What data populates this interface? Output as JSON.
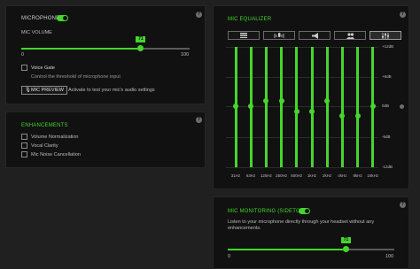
{
  "colors": {
    "accent": "#44d62c",
    "panel": "#111111",
    "background": "#202020"
  },
  "microphone": {
    "title": "MICROPHONE",
    "toggle_on": true,
    "volume_label": "MIC VOLUME",
    "volume_value": "71",
    "volume_percent": 71,
    "min_label": "0",
    "max_label": "100",
    "voice_gate_label": "Voice Gate",
    "voice_gate_desc": "Control the threshold of microphone input",
    "preview_button": "MIC PREVIEW",
    "preview_desc": "Activate to test your mic's audio settings",
    "help_icon": "question-icon"
  },
  "enhancements": {
    "title": "ENHANCEMENTS",
    "items": [
      {
        "label": "Volume Normalization",
        "checked": false
      },
      {
        "label": "Vocal Clarity",
        "checked": false
      },
      {
        "label": "Mic Noise Cancellation",
        "checked": false
      }
    ]
  },
  "equalizer": {
    "title": "MIC EQUALIZER",
    "presets": [
      {
        "icon": "default-preset-icon",
        "active": false
      },
      {
        "icon": "broadcast-mic-preset-icon",
        "active": false
      },
      {
        "icon": "megaphone-preset-icon",
        "active": false
      },
      {
        "icon": "people-preset-icon",
        "active": false
      },
      {
        "icon": "custom-eq-preset-icon",
        "active": true
      }
    ],
    "db_labels": [
      "+12dB",
      "+6dB",
      "0dB",
      "-6dB",
      "-12dB"
    ],
    "bands": [
      {
        "freq": "31Hz",
        "gain": 0
      },
      {
        "freq": "63Hz",
        "gain": 0
      },
      {
        "freq": "125Hz",
        "gain": 1
      },
      {
        "freq": "250Hz",
        "gain": 1
      },
      {
        "freq": "500Hz",
        "gain": -1
      },
      {
        "freq": "1kHz",
        "gain": -1
      },
      {
        "freq": "2kHz",
        "gain": 1
      },
      {
        "freq": "4kHz",
        "gain": -2
      },
      {
        "freq": "8kHz",
        "gain": -2
      },
      {
        "freq": "16kHz",
        "gain": 0
      }
    ]
  },
  "sidetone": {
    "title": "MIC MONITORING (SIDETONE)",
    "toggle_on": true,
    "desc": "Listen to your microphone directly through your headset without any enhancements.",
    "value": "71",
    "value_percent": 71,
    "min_label": "0",
    "max_label": "100"
  }
}
